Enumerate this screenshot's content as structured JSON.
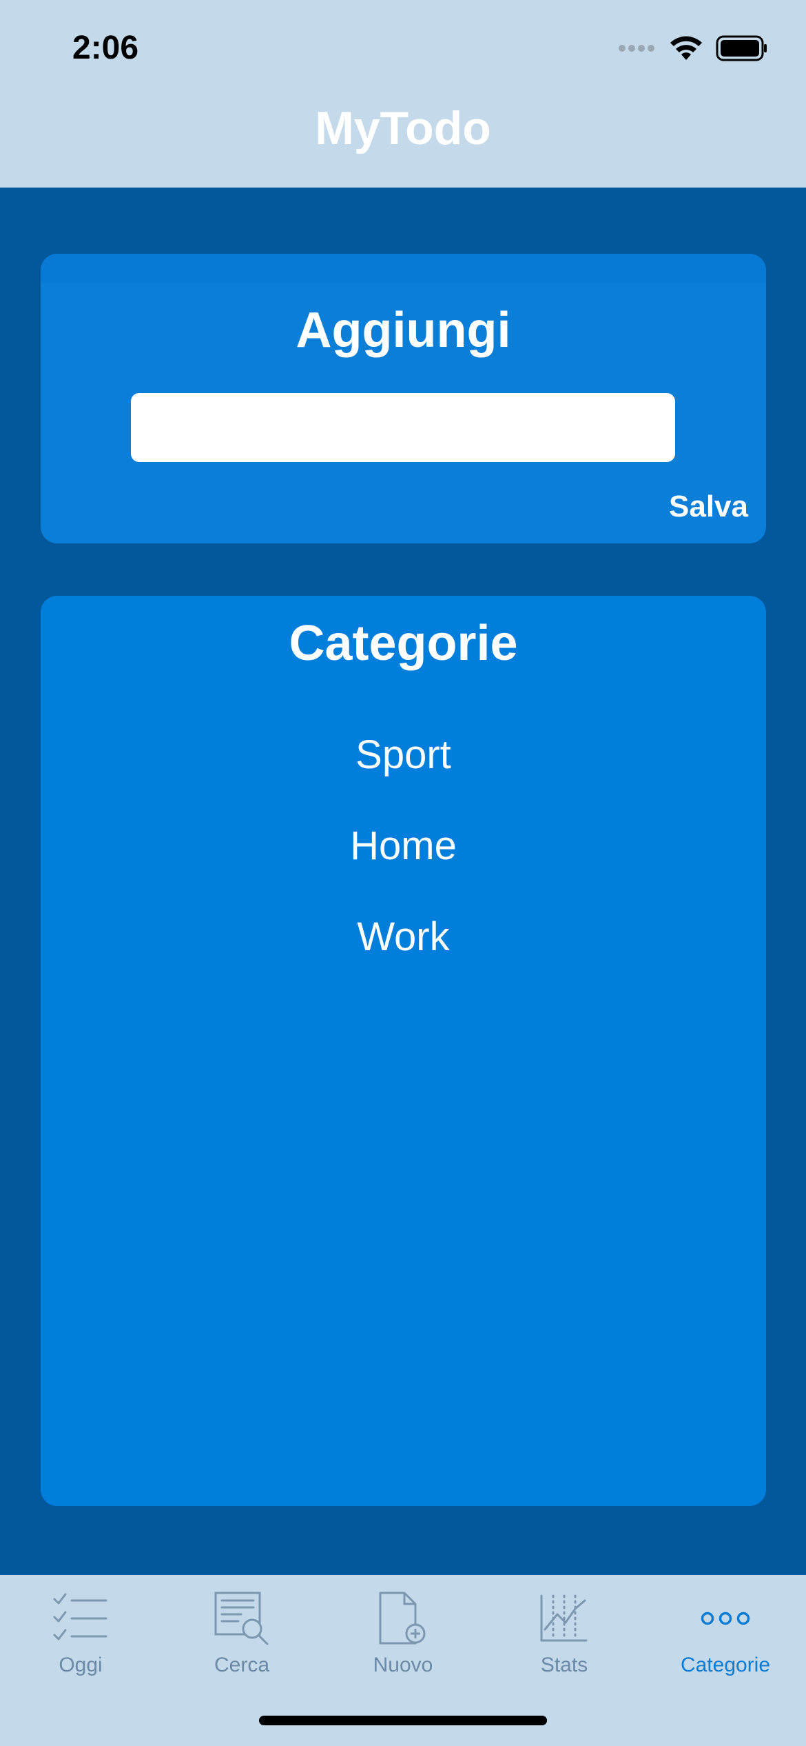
{
  "status": {
    "time": "2:06"
  },
  "app": {
    "title": "MyTodo"
  },
  "add_card": {
    "title": "Aggiungi",
    "input_value": "",
    "input_placeholder": "",
    "save_label": "Salva"
  },
  "categories_card": {
    "title": "Categorie",
    "items": [
      "Sport",
      "Home",
      "Work"
    ]
  },
  "tabs": [
    {
      "label": "Oggi",
      "icon": "checklist-icon"
    },
    {
      "label": "Cerca",
      "icon": "document-search-icon"
    },
    {
      "label": "Nuovo",
      "icon": "new-document-icon"
    },
    {
      "label": "Stats",
      "icon": "chart-icon"
    },
    {
      "label": "Categorie",
      "icon": "more-icon",
      "active": true
    }
  ],
  "colors": {
    "bar_bg": "#c4daea",
    "page_bg": "#02589a",
    "card_add": "#0b7fd8",
    "card_cats": "#007edb",
    "tab_inactive": "#6b8aa8",
    "tab_active": "#0b7bd3"
  }
}
